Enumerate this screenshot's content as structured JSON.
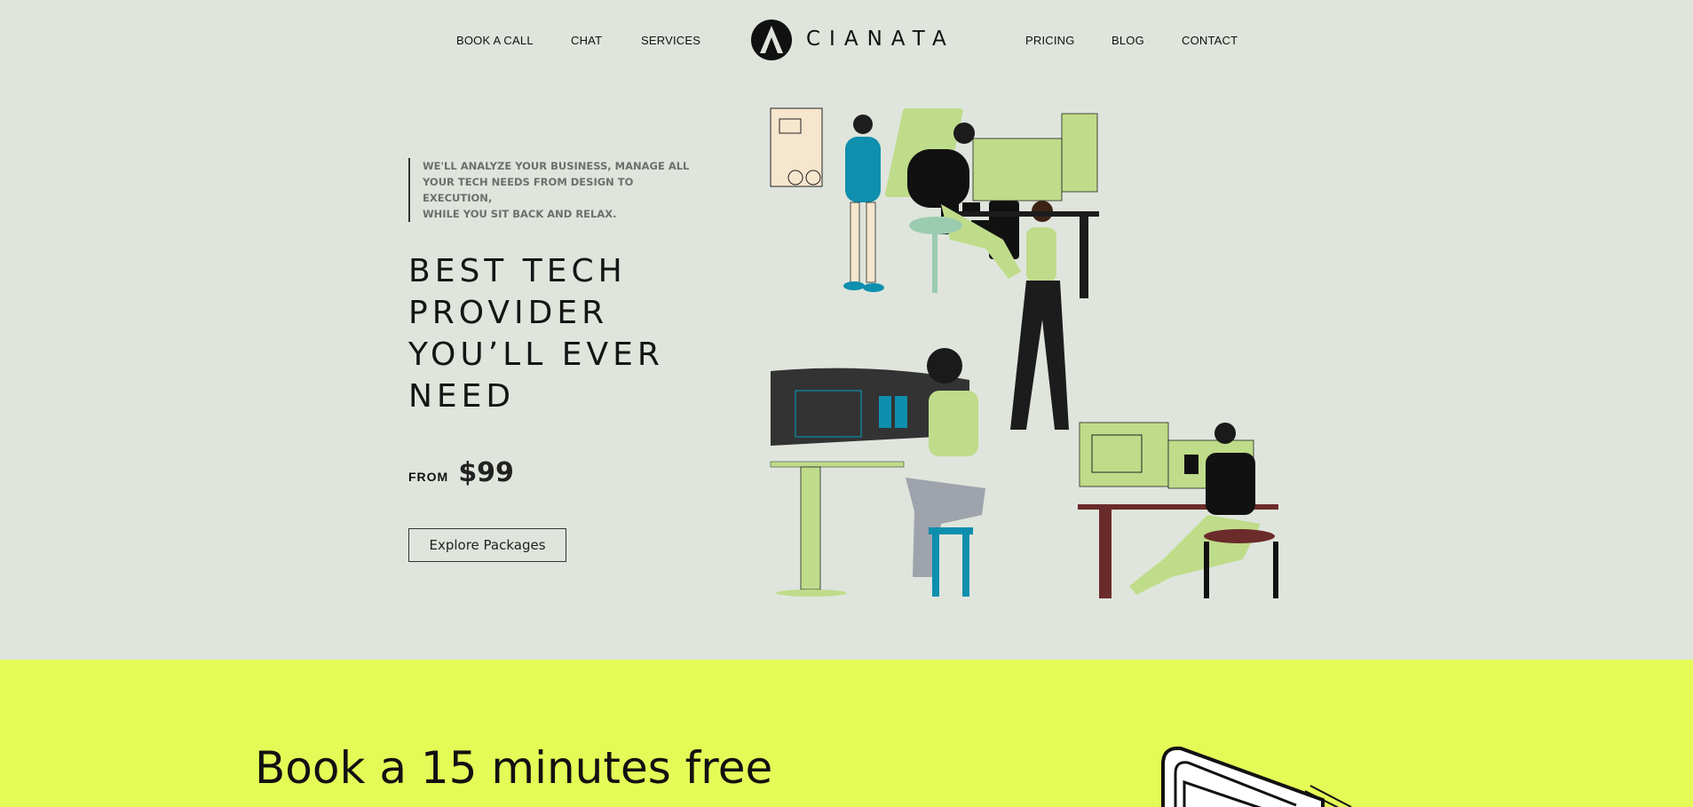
{
  "nav": {
    "left": [
      "BOOK A CALL",
      "CHAT",
      "SERVICES"
    ],
    "right": [
      "PRICING",
      "BLOG",
      "CONTACT"
    ],
    "logo_text": "CIANATA"
  },
  "hero": {
    "tagline": [
      "WE'LL ANALYZE YOUR BUSINESS, MANAGE ALL",
      "YOUR TECH NEEDS FROM DESIGN TO EXECUTION,",
      "WHILE YOU SIT BACK AND RELAX."
    ],
    "headline": [
      "BEST TECH",
      "PROVIDER",
      "YOU’LL EVER",
      "NEED"
    ],
    "price_prefix": "FROM",
    "price_value": "$99",
    "cta_label": "Explore Packages"
  },
  "band": {
    "title": [
      "Book a 15 minutes free"
    ]
  },
  "colors": {
    "hero_bg": "#dfe5dc",
    "band_bg": "#e4fb57",
    "accent_green": "#bfdc8a",
    "accent_teal": "#0e8fae",
    "dark": "#111111"
  },
  "icons": {
    "logo": "logo-mark-icon",
    "illustration": "team-working-illustration",
    "band_art": "laptop-outline-illustration"
  }
}
